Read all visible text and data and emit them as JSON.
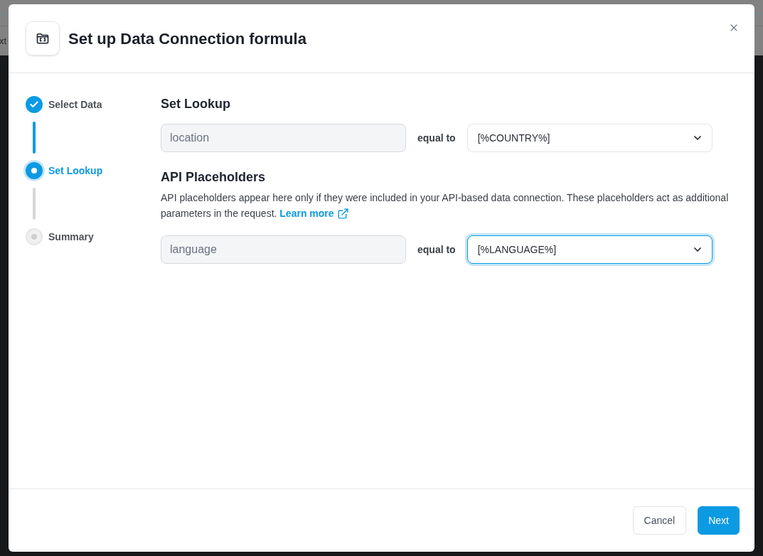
{
  "background": {
    "side_text": "xt"
  },
  "dialog": {
    "title": "Set up Data Connection formula"
  },
  "steps": [
    {
      "label": "Select Data",
      "completed": true,
      "selected": false
    },
    {
      "label": "Set Lookup",
      "completed": false,
      "selected": true
    },
    {
      "label": "Summary",
      "completed": false,
      "selected": false
    }
  ],
  "lookup": {
    "heading": "Set Lookup",
    "rows": [
      {
        "field": {
          "value": "location",
          "disabled": true
        },
        "operator": "equal to",
        "select": {
          "value": "[%COUNTRY%]",
          "focused": false
        }
      }
    ]
  },
  "api_placeholders": {
    "heading": "API Placeholders",
    "description": "API placeholders appear here only if they were included in your API-based data connection. These placeholders act as additional parameters in the request.",
    "link": "Learn more",
    "rows": [
      {
        "field": {
          "value": "language",
          "disabled": true
        },
        "operator": "equal to",
        "select": {
          "value": "[%LANGUAGE%]",
          "focused": true
        }
      }
    ]
  },
  "buttons": [
    {
      "label": "Cancel",
      "kind": "secondary"
    },
    {
      "label": "Next",
      "kind": "primary"
    }
  ]
}
